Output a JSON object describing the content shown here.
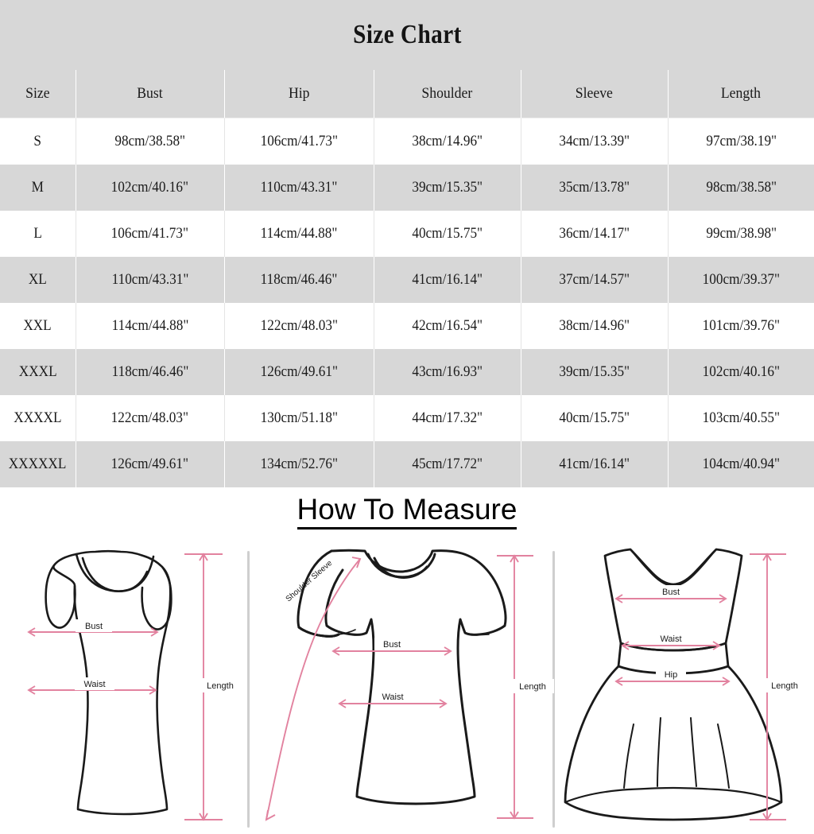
{
  "header": {
    "title": "Size Chart",
    "background_color": "#d7d7d7"
  },
  "table": {
    "columns": [
      "Size",
      "Bust",
      "Hip",
      "Shoulder",
      "Sleeve",
      "Length"
    ],
    "header_bg": "#d7d7d7",
    "stripe_bg": "#d7d7d7",
    "rows": [
      {
        "size": "S",
        "bust": "98cm/38.58\"",
        "hip": "106cm/41.73\"",
        "shoulder": "38cm/14.96\"",
        "sleeve": "34cm/13.39\"",
        "length": "97cm/38.19\""
      },
      {
        "size": "M",
        "bust": "102cm/40.16\"",
        "hip": "110cm/43.31\"",
        "shoulder": "39cm/15.35\"",
        "sleeve": "35cm/13.78\"",
        "length": "98cm/38.58\""
      },
      {
        "size": "L",
        "bust": "106cm/41.73\"",
        "hip": "114cm/44.88\"",
        "shoulder": "40cm/15.75\"",
        "sleeve": "36cm/14.17\"",
        "length": "99cm/38.98\""
      },
      {
        "size": "XL",
        "bust": "110cm/43.31\"",
        "hip": "118cm/46.46\"",
        "shoulder": "41cm/16.14\"",
        "sleeve": "37cm/14.57\"",
        "length": "100cm/39.37\""
      },
      {
        "size": "XXL",
        "bust": "114cm/44.88\"",
        "hip": "122cm/48.03\"",
        "shoulder": "42cm/16.54\"",
        "sleeve": "38cm/14.96\"",
        "length": "101cm/39.76\""
      },
      {
        "size": "XXXL",
        "bust": "118cm/46.46\"",
        "hip": "126cm/49.61\"",
        "shoulder": "43cm/16.93\"",
        "sleeve": "39cm/15.35\"",
        "length": "102cm/40.16\""
      },
      {
        "size": "XXXXL",
        "bust": "122cm/48.03\"",
        "hip": "130cm/51.18\"",
        "shoulder": "44cm/17.32\"",
        "sleeve": "40cm/15.75\"",
        "length": "103cm/40.55\""
      },
      {
        "size": "XXXXXL",
        "bust": "126cm/49.61\"",
        "hip": "134cm/52.76\"",
        "shoulder": "45cm/17.72\"",
        "sleeve": "41cm/16.14\"",
        "length": "104cm/40.94\""
      }
    ]
  },
  "measure": {
    "heading": "How To Measure",
    "accent_color": "#e2829f",
    "outline_color": "#1a1a1a",
    "divider_color": "#cfcfcf",
    "panels": [
      {
        "garment": "sleeveless-tank-top",
        "labels": {
          "bust": "Bust",
          "waist": "Waist",
          "length": "Length"
        }
      },
      {
        "garment": "short-sleeve-tshirt",
        "labels": {
          "shoulder_sleeve": "Shoulder Sleeve",
          "bust": "Bust",
          "waist": "Waist",
          "length": "Length"
        }
      },
      {
        "garment": "sleeveless-flared-dress",
        "labels": {
          "bust": "Bust",
          "waist": "Waist",
          "hip": "Hip",
          "length": "Length"
        }
      }
    ]
  }
}
